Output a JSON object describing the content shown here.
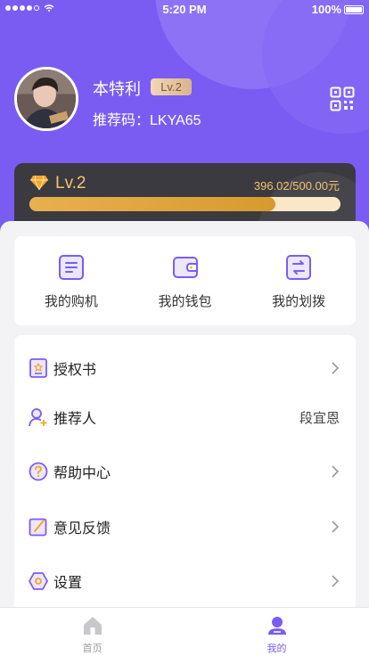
{
  "status_bar": {
    "time": "5:20 PM",
    "battery": "100%"
  },
  "profile": {
    "name": "本特利",
    "level_badge": "Lv.2",
    "referral_code": "推荐码：LKYA65"
  },
  "level_card": {
    "level": "Lv.2",
    "progress_text": "396.02/500.00元",
    "progress_fraction": 0.792
  },
  "quick_actions": [
    {
      "label": "我的购机",
      "icon": "document-icon"
    },
    {
      "label": "我的钱包",
      "icon": "wallet-icon"
    },
    {
      "label": "我的划拨",
      "icon": "transfer-icon"
    }
  ],
  "menu": [
    {
      "label": "授权书",
      "icon": "certificate-icon",
      "value": ""
    },
    {
      "label": "推荐人",
      "icon": "user-add-icon",
      "value": "段宜恩"
    },
    {
      "label": "帮助中心",
      "icon": "help-icon",
      "value": ""
    },
    {
      "label": "意见反馈",
      "icon": "feedback-icon",
      "value": ""
    },
    {
      "label": "设置",
      "icon": "settings-icon",
      "value": ""
    }
  ],
  "tabbar": [
    {
      "label": "首页",
      "icon": "home-icon"
    },
    {
      "label": "我的",
      "icon": "profile-icon",
      "active": true
    }
  ],
  "colors": {
    "accent": "#7b5cf2",
    "gold": "#f3c36e",
    "dark_card": "#3b3a40"
  }
}
